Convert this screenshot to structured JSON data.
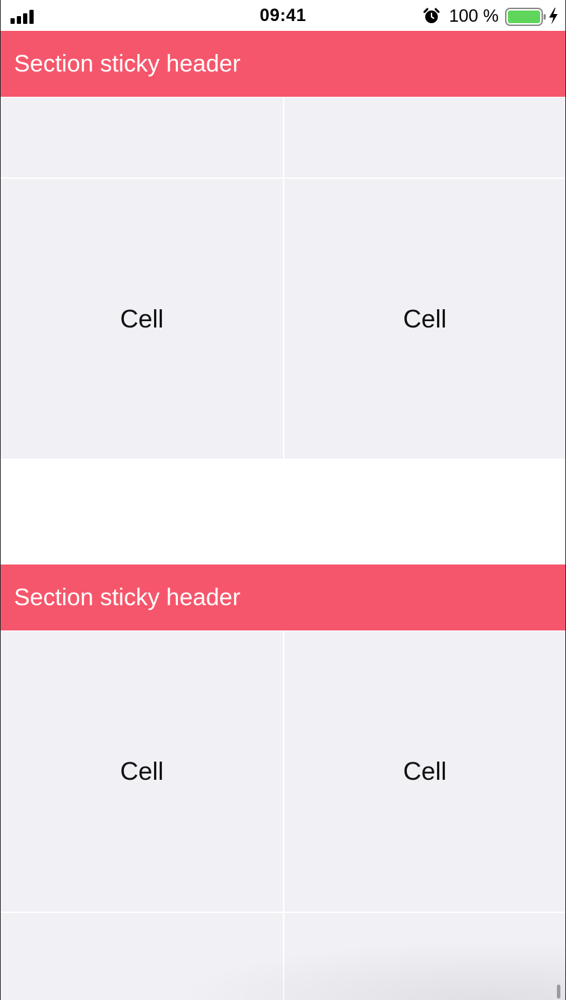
{
  "status_bar": {
    "time": "09:41",
    "battery_percent": "100 %",
    "battery_level": 1.0,
    "icons": [
      "signal-icon",
      "alarm-icon",
      "battery-icon",
      "charging-bolt-icon"
    ]
  },
  "sections": [
    {
      "header": "Section sticky header",
      "cells": [
        "",
        "",
        "Cell",
        "Cell"
      ]
    },
    {
      "header": "Section sticky header",
      "cells": [
        "Cell",
        "Cell",
        "",
        ""
      ]
    }
  ],
  "colors": {
    "header_background": "#f6566b",
    "header_text": "#ffffff",
    "cell_background": "#f1f0f5",
    "battery_fill": "#5fd65b"
  }
}
